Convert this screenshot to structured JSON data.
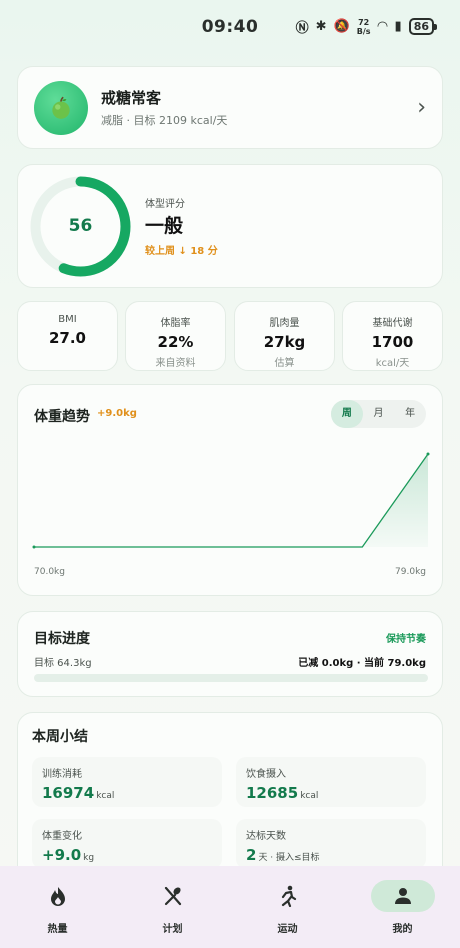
{
  "status_bar": {
    "time": "09:40",
    "net_speed_value": "72",
    "net_speed_unit": "B/s",
    "battery": "86"
  },
  "profile": {
    "name": "戒糖常客",
    "subtitle": "减脂 · 目标 2109 kcal/天",
    "avatar_icon": "apple-icon"
  },
  "score": {
    "value": "56",
    "fraction": 0.56,
    "label": "体型评分",
    "level": "一般",
    "compare": "较上周 ↓ 18 分"
  },
  "metrics": [
    {
      "label": "BMI",
      "value": "27.0",
      "sub": ""
    },
    {
      "label": "体脂率",
      "value": "22%",
      "sub": "来自资料"
    },
    {
      "label": "肌肉量",
      "value": "27kg",
      "sub": "估算"
    },
    {
      "label": "基础代谢",
      "value": "1700",
      "sub": "kcal/天"
    }
  ],
  "trend": {
    "title": "体重趋势",
    "delta": "+9.0kg",
    "tabs": [
      "周",
      "月",
      "年"
    ],
    "active_tab": 0,
    "min_label": "70.0kg",
    "max_label": "79.0kg"
  },
  "chart_data": {
    "type": "area",
    "title": "体重趋势",
    "x": [
      0,
      1,
      2,
      3,
      4,
      5,
      6
    ],
    "values": [
      70.0,
      70.0,
      70.0,
      70.0,
      70.0,
      70.0,
      79.0
    ],
    "ylim": [
      70.0,
      79.0
    ],
    "color": "#1b9a5a"
  },
  "goal": {
    "title": "目标进度",
    "status": "保持节奏",
    "target": "目标 64.3kg",
    "progress_text": "已减 0.0kg · 当前 79.0kg",
    "fraction": 0.0
  },
  "summary": {
    "title": "本周小结",
    "stats": [
      {
        "label": "训练消耗",
        "value": "16974",
        "unit": "kcal"
      },
      {
        "label": "饮食摄入",
        "value": "12685",
        "unit": "kcal"
      },
      {
        "label": "体重变化",
        "value": "+9.0",
        "unit": "kg"
      },
      {
        "label": "达标天数",
        "value": "2",
        "unit": "天 · 摄入≤目标"
      }
    ]
  },
  "nav": {
    "items": [
      {
        "label": "热量",
        "icon": "flame-icon"
      },
      {
        "label": "计划",
        "icon": "utensils-icon"
      },
      {
        "label": "运动",
        "icon": "run-icon"
      },
      {
        "label": "我的",
        "icon": "person-icon"
      }
    ],
    "active": 3
  },
  "colors": {
    "accent": "#1b9a5a",
    "warning": "#e0901b"
  }
}
